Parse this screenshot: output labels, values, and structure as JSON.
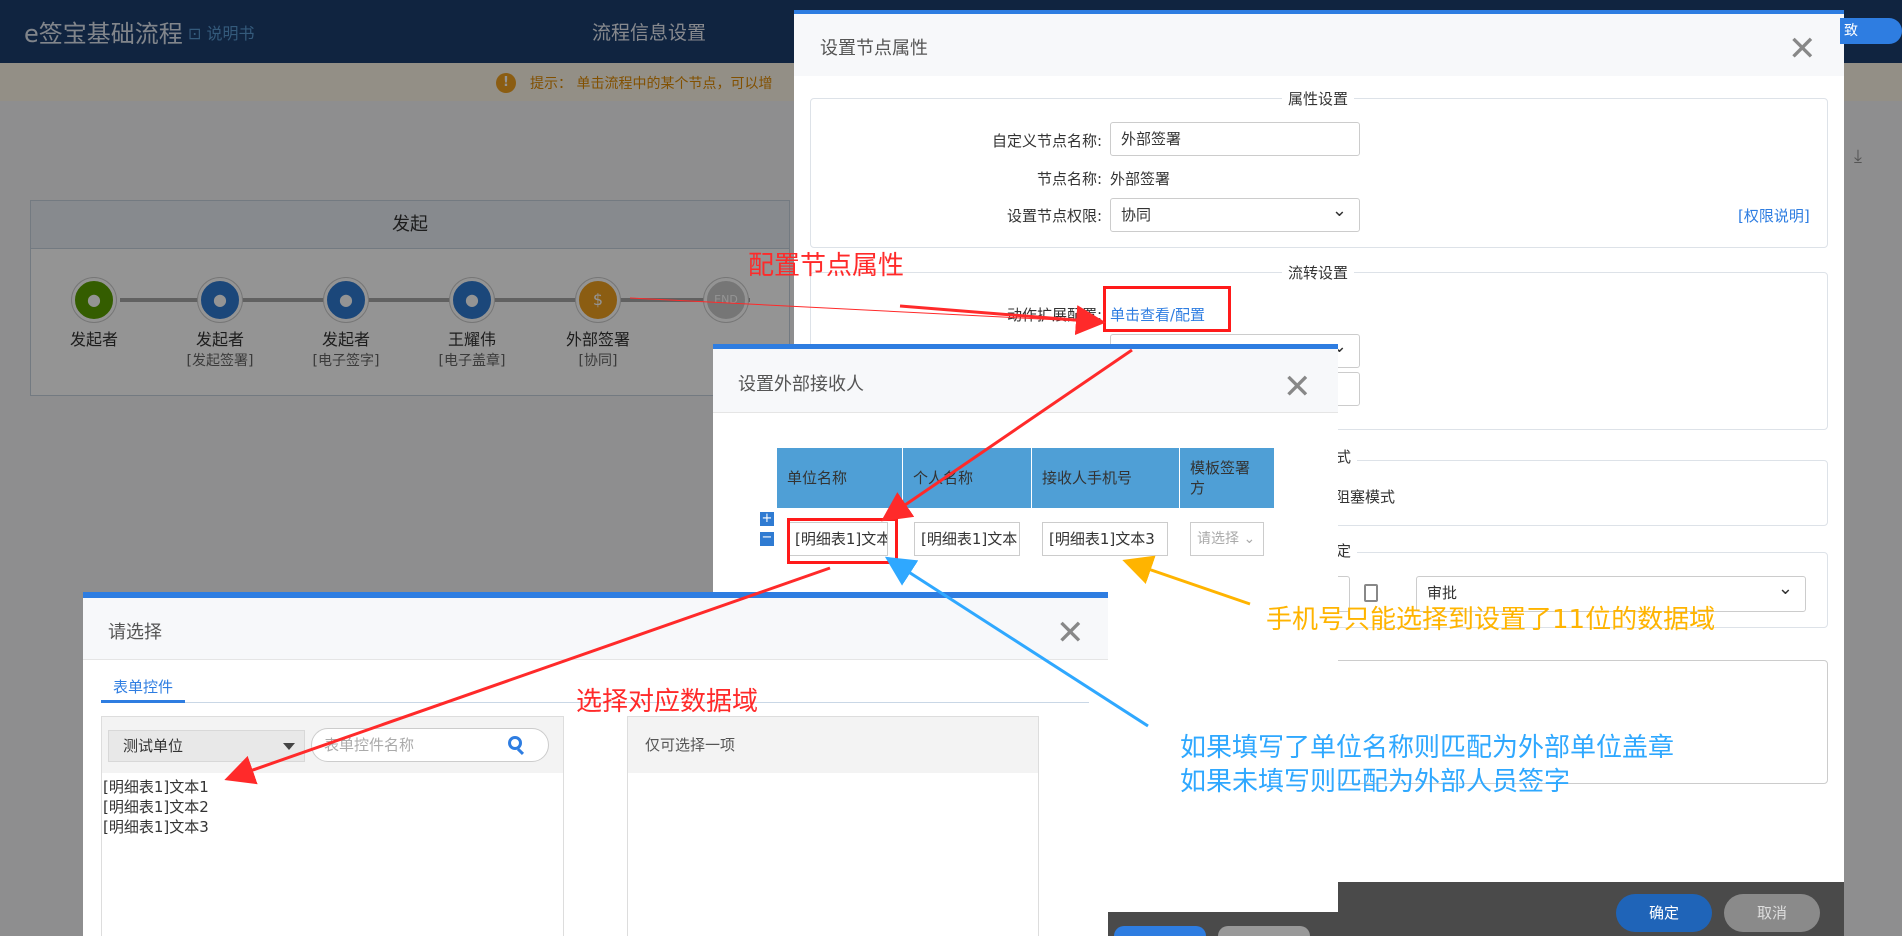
{
  "topbar": {
    "app_title": "e签宝基础流程",
    "manual_link": "说明书",
    "flow_info_title": "流程信息设置"
  },
  "hint": {
    "icon": "!",
    "text": "提示： 单击流程中的某个节点，可以增"
  },
  "flow": {
    "start_label": "发起",
    "nodes": [
      {
        "name": "发起者",
        "sub": "",
        "color": "#5aa000",
        "icon": "person-icon"
      },
      {
        "name": "发起者",
        "sub": "[发起签署]",
        "color": "#2f7bd2",
        "icon": "monitor-person-icon"
      },
      {
        "name": "发起者",
        "sub": "[电子签字]",
        "color": "#2f7bd2",
        "icon": "monitor-person-icon"
      },
      {
        "name": "王耀伟",
        "sub": "[电子盖章]",
        "color": "#2f7bd2",
        "icon": "person-icon"
      },
      {
        "name": "外部签署",
        "sub": "[协同]",
        "color": "#f0a020",
        "icon": "dollar-shield-icon"
      }
    ],
    "end_label": "END"
  },
  "node_dialog": {
    "title": "设置节点属性",
    "attr_section": "属性设置",
    "custom_name_label": "自定义节点名称:",
    "custom_name_value": "外部签署",
    "node_name_label": "节点名称:",
    "node_name_value": "外部签署",
    "permission_label": "设置节点权限:",
    "permission_value": "协同",
    "permission_link": "[权限说明]",
    "flow_section": "流转设置",
    "action_label": "动作扩展配置:",
    "action_link": "单击查看/配置",
    "mode_section_partial": "式",
    "mode_value": "非阻塞模式",
    "set_partial": "定",
    "approve_value": "审批",
    "confirm": "确定",
    "cancel": "取消"
  },
  "ext_dialog": {
    "title": "设置外部接收人",
    "columns": [
      "单位名称",
      "个人名称",
      "接收人手机号",
      "模板签署方"
    ],
    "row": [
      "[明细表1]文本",
      "[明细表1]文本",
      "[明细表1]文本3",
      "请选择"
    ]
  },
  "choose_dialog": {
    "title": "请选择",
    "tab": "表单控件",
    "unit_select": "测试单位",
    "search_placeholder": "表单控件名称",
    "items": [
      "[明细表1]文本1",
      "[明细表1]文本2",
      "[明细表1]文本3"
    ],
    "right_hint": "仅可选择一项"
  },
  "annotations": {
    "config_node": "配置节点属性",
    "phone_note": "手机号只能选择到设置了11位的数据域",
    "select_domain": "选择对应数据域",
    "match_line1": "如果填写了单位名称则匹配为外部单位盖章",
    "match_line2": "如果未填写则匹配为外部人员签字",
    "colors": {
      "red": "#ff2a2a",
      "orange": "#ffb400",
      "blue": "#2fa8ff"
    }
  }
}
